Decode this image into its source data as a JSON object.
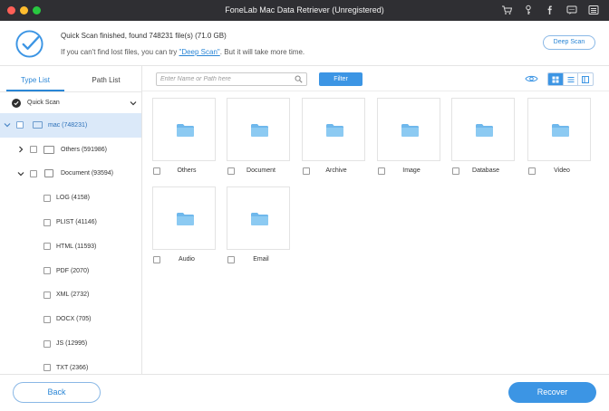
{
  "window": {
    "title": "FoneLab Mac Data Retriever (Unregistered)",
    "toolbar_icons": [
      "cart-icon",
      "key-icon",
      "facebook-icon",
      "chat-icon",
      "menu-icon"
    ]
  },
  "header": {
    "status_line1": "Quick Scan finished, found 748231 file(s) (71.0 GB)",
    "status_line2_prefix": "If you can't find lost files, you can try ",
    "status_line2_link": "\"Deep Scan\"",
    "status_line2_suffix": ". But it will take more time.",
    "deep_scan_label": "Deep Scan"
  },
  "sidebar": {
    "tabs": [
      {
        "label": "Type List",
        "active": true
      },
      {
        "label": "Path List",
        "active": false
      }
    ],
    "quick_scan_label": "Quick Scan",
    "tree": {
      "drive": "mac (748231)",
      "others": "Others (591986)",
      "document": "Document (93594)",
      "children": [
        "LOG (4158)",
        "PLIST (41146)",
        "HTML (11593)",
        "PDF (2070)",
        "XML (2732)",
        "DOCX (705)",
        "JS (12995)",
        "TXT (2366)"
      ]
    }
  },
  "toolbar": {
    "search_placeholder": "Enter Name or Path here",
    "filter_label": "Filter",
    "view_modes": [
      "grid",
      "list",
      "columns"
    ],
    "active_view": "grid"
  },
  "grid": {
    "folders": [
      "Others",
      "Document",
      "Archive",
      "Image",
      "Database",
      "Video",
      "Audio",
      "Email"
    ]
  },
  "footer": {
    "back_label": "Back",
    "recover_label": "Recover"
  },
  "colors": {
    "accent": "#3c95e4",
    "folder": "#6fb8ec",
    "titlebar": "#2f2f33",
    "selected_row": "#dbe9f9"
  }
}
